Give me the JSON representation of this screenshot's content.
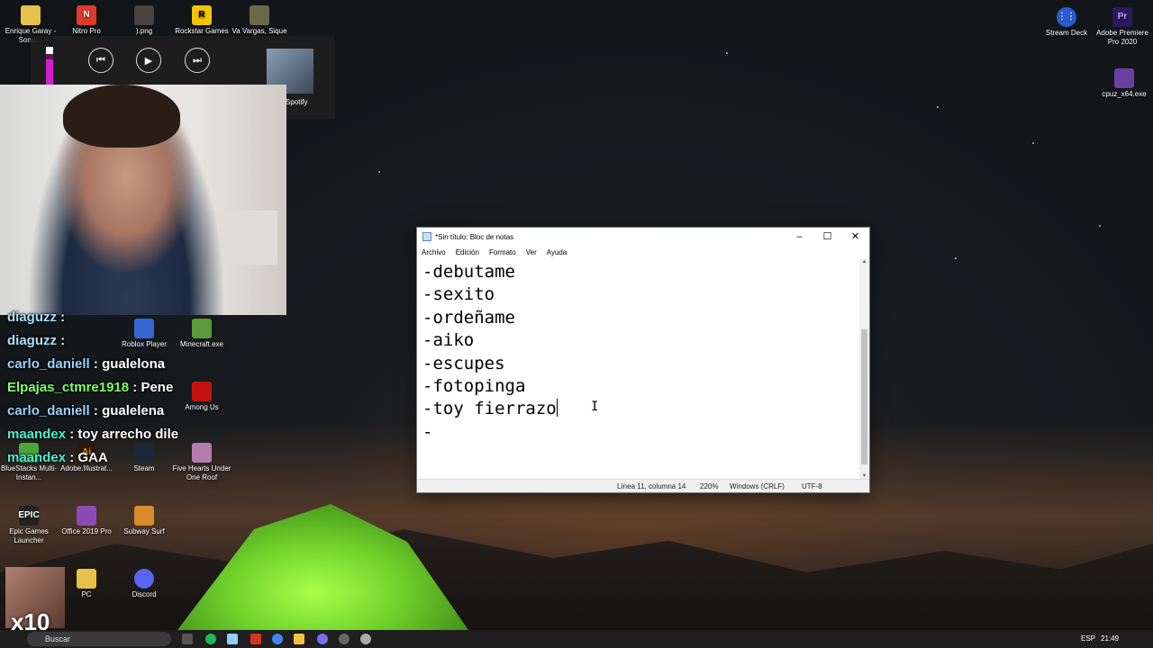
{
  "desktop_icons_top": [
    {
      "label": "Enrique Garay - Sonic...",
      "icon": "folder-icon",
      "color": "#e8c14a"
    },
    {
      "label": "Nitro Pro",
      "icon": "nitro-pro-icon",
      "color": "#e03a2f"
    },
    {
      "label": ").png",
      "icon": "image-file-icon",
      "color": "#444444"
    },
    {
      "label": "Rockstar Games",
      "icon": "rockstar-icon",
      "color": "#f4c400"
    },
    {
      "label": "Va Vargas, Sique",
      "icon": "image-file-icon",
      "color": "#6a6a4a"
    }
  ],
  "desktop_icons_right": [
    {
      "label": "Stream Deck",
      "icon": "stream-deck-icon",
      "color": "#2a5bd7"
    },
    {
      "label": "Adobe Premiere Pro 2020",
      "icon": "premiere-icon",
      "color": "#2a1a5e"
    },
    {
      "label": "cpuz_x64.exe",
      "icon": "cpuz-icon",
      "color": "#6b3fa0"
    }
  ],
  "desktop_icons_left": [
    {
      "label": "Roblox Player",
      "icon": "roblox-icon",
      "color": "#3568d4"
    },
    {
      "label": "Minecraft.exe",
      "icon": "minecraft-icon",
      "color": "#5a9a3a"
    },
    {
      "label": "Among Us",
      "icon": "among-us-icon",
      "color": "#c51111"
    },
    {
      "label": "BlueStacks Multi-Instan...",
      "icon": "bluestacks-icon",
      "color": "#4aa73a"
    },
    {
      "label": "Adobe.Illustrat...",
      "icon": "illustrator-icon",
      "color": "#2a1a0a"
    },
    {
      "label": "Steam",
      "icon": "steam-icon",
      "color": "#1b2838"
    },
    {
      "label": "Five Hearts Under One Roof",
      "icon": "game-icon",
      "color": "#b57cb0"
    },
    {
      "label": "Epic Games Launcher",
      "icon": "epic-icon",
      "color": "#222222"
    },
    {
      "label": "Office 2019 Pro",
      "icon": "office-icon",
      "color": "#8a4ab8"
    },
    {
      "label": "Subway Surf",
      "icon": "subway-surf-icon",
      "color": "#d98a2a"
    },
    {
      "label": "PC",
      "icon": "pc-icon",
      "color": "#e8c14a"
    },
    {
      "label": "Discord",
      "icon": "discord-icon",
      "color": "#5865f2"
    }
  ],
  "media": {
    "source": "Spotify"
  },
  "chat": [
    {
      "user": "diaguzz",
      "text": "",
      "color": "#a8e0ff"
    },
    {
      "user": "diaguzz",
      "text": "",
      "color": "#a8e0ff"
    },
    {
      "user": "carlo_daniell",
      "text": "gualelona",
      "color": "#9ed0ff"
    },
    {
      "user": "Elpajas_ctmre1918",
      "text": "Pene",
      "color": "#7fff6a"
    },
    {
      "user": "carlo_daniell",
      "text": "gualelena",
      "color": "#9ed0ff"
    },
    {
      "user": "maandex",
      "text": "toy arrecho dile",
      "color": "#4af0d0"
    },
    {
      "user": "maandex",
      "text": "GAA",
      "color": "#4af0d0"
    }
  ],
  "notepad": {
    "title": "*Sin título: Bloc de notas",
    "menu": [
      "Archivo",
      "Edición",
      "Formato",
      "Ver",
      "Ayuda"
    ],
    "lines": [
      "-debutame",
      "-sexito",
      "-ordeñame",
      "-aiko",
      "-escupes",
      "-fotopinga",
      "-toy fierrazo",
      "-"
    ],
    "status": {
      "position": "Línea 11, columna 14",
      "zoom": "220%",
      "eol": "Windows (CRLF)",
      "encoding": "UTF-8"
    }
  },
  "taskbar": {
    "search_label": "Buscar",
    "language": "ESP",
    "time": "21:49"
  },
  "overlay_badge": "x10"
}
